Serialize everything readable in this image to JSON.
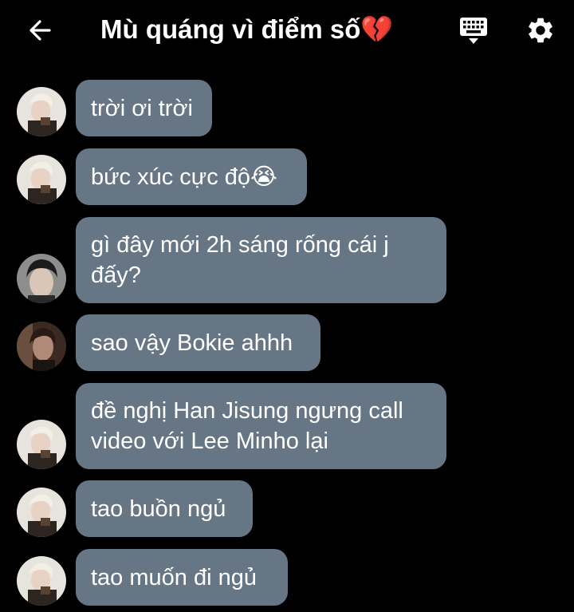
{
  "header": {
    "title": "Mù quáng vì điểm số💔",
    "back_icon": "arrow-left-icon",
    "keyboard_icon": "keyboard-icon",
    "settings_icon": "gear-icon"
  },
  "messages": [
    {
      "text": "trời ơi trời",
      "avatar": "avatar-blond"
    },
    {
      "text": "bức xúc cực độ😭",
      "avatar": "avatar-blond"
    },
    {
      "text": "gì đây mới 2h sáng rống cái j\nđấy?",
      "avatar": "avatar-dark-hair"
    },
    {
      "text": "sao vậy Bokie ahhh",
      "avatar": "avatar-brown-hair"
    },
    {
      "text": "đề nghị Han Jisung ngưng call\nvideo với Lee Minho lại",
      "avatar": "avatar-blond"
    },
    {
      "text": "tao buồn ngủ",
      "avatar": "avatar-blond"
    },
    {
      "text": "tao muốn đi ngủ",
      "avatar": "avatar-blond"
    }
  ],
  "colors": {
    "background": "#000000",
    "bubble": "#677685",
    "text": "#ffffff"
  }
}
